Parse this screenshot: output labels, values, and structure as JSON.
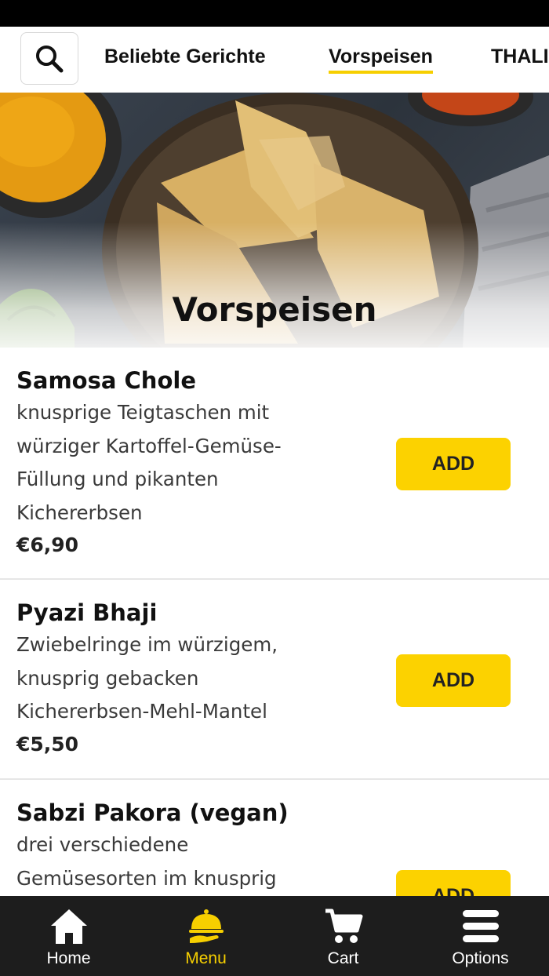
{
  "nav": {
    "tabs": [
      {
        "label": "Beliebte Gerichte"
      },
      {
        "label": "Vorspeisen"
      },
      {
        "label": "THALI"
      }
    ],
    "active_tab": "Vorspeisen"
  },
  "hero": {
    "title": "Vorspeisen"
  },
  "items": [
    {
      "name": "Samosa Chole",
      "description": "knusprige Teigtaschen mit würziger Kartoffel-Gemüse-Füllung und pikanten Kichererbsen",
      "price": "€6,90",
      "add_label": "ADD"
    },
    {
      "name": "Pyazi Bhaji",
      "description": "Zwiebelringe im würzigem, knusprig gebacken Kichererbsen-Mehl-Mantel",
      "price": "€5,50",
      "add_label": "ADD"
    },
    {
      "name": "Sabzi Pakora (vegan)",
      "description": "drei verschiedene Gemüsesorten im knusprig",
      "price": "",
      "add_label": "ADD"
    }
  ],
  "bottom_nav": [
    {
      "label": "Home",
      "icon": "home-icon"
    },
    {
      "label": "Menu",
      "icon": "cloche-icon"
    },
    {
      "label": "Cart",
      "icon": "cart-icon"
    },
    {
      "label": "Options",
      "icon": "menu-icon"
    }
  ],
  "colors": {
    "accent": "#fcd200",
    "active_text": "#f6cf00",
    "bottom_bar": "#1d1d1d"
  }
}
